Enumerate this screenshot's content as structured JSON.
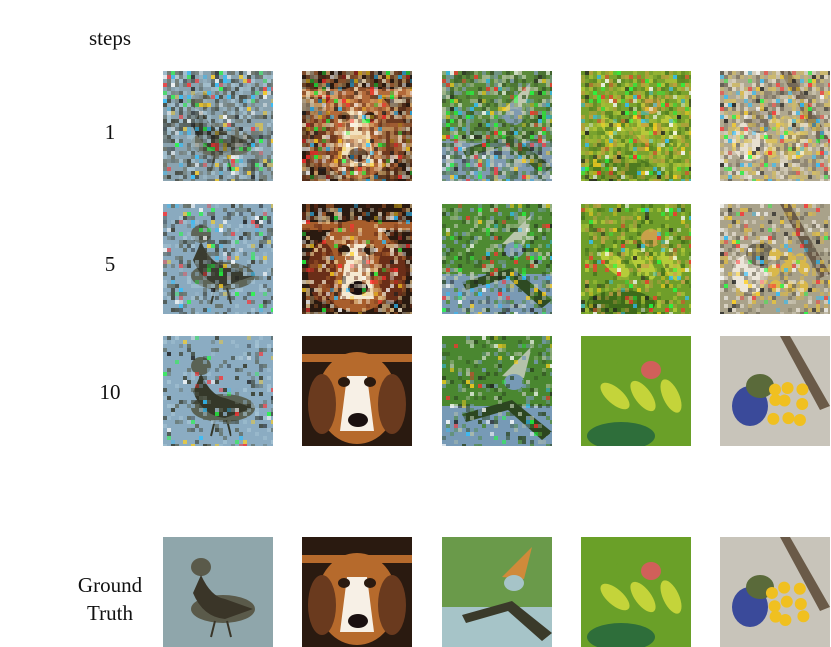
{
  "header_label": "steps",
  "rows": [
    {
      "label": "1",
      "tiles": [
        {
          "subject": "bird",
          "stage": "noisy-1",
          "palette": [
            "#8aa3b0",
            "#6b6f62",
            "#a9c7d6",
            "#3d3f33"
          ]
        },
        {
          "subject": "dog",
          "stage": "noisy-1",
          "palette": [
            "#b36a3a",
            "#e0b070",
            "#6e3a20",
            "#f2e2c0"
          ]
        },
        {
          "subject": "branch-bird",
          "stage": "noisy-1",
          "palette": [
            "#5a8a3a",
            "#7f9ab0",
            "#3a5a2a",
            "#c0c8b0"
          ]
        },
        {
          "subject": "parrot",
          "stage": "noisy-1",
          "palette": [
            "#7aa32e",
            "#b8c83a",
            "#4e7a20",
            "#c8a040"
          ]
        },
        {
          "subject": "lorikeet",
          "stage": "noisy-1",
          "palette": [
            "#b0a890",
            "#d8c060",
            "#7a7060",
            "#e8e0d0"
          ]
        }
      ]
    },
    {
      "label": "5",
      "tiles": [
        {
          "subject": "bird",
          "stage": "noisy-5",
          "palette": [
            "#8aaabf",
            "#5e6558",
            "#a7c4d4",
            "#3a3c30"
          ]
        },
        {
          "subject": "dog",
          "stage": "noisy-5",
          "palette": [
            "#a85e2c",
            "#e8c890",
            "#6a2e18",
            "#f5ead2"
          ]
        },
        {
          "subject": "branch-bird",
          "stage": "noisy-5",
          "palette": [
            "#4e8a32",
            "#7a9ab4",
            "#2e4a22",
            "#b9c6ac"
          ]
        },
        {
          "subject": "parrot",
          "stage": "noisy-5",
          "palette": [
            "#6f9e2a",
            "#b6cc3a",
            "#3e6a1a",
            "#c9a04a"
          ]
        },
        {
          "subject": "lorikeet",
          "stage": "noisy-5",
          "palette": [
            "#a9a28a",
            "#d9b84a",
            "#6e6858",
            "#ece6da"
          ]
        }
      ]
    },
    {
      "label": "10",
      "tiles": [
        {
          "subject": "bird",
          "stage": "noisy-10",
          "palette": [
            "#8bacc2",
            "#5a6254",
            "#a8c6d6",
            "#353829"
          ]
        },
        {
          "subject": "dog",
          "stage": "clean",
          "palette": [
            "#b66a2c",
            "#f0d6b0",
            "#6a3a1e",
            "#f7f0e6"
          ]
        },
        {
          "subject": "branch-bird",
          "stage": "noisy-10",
          "palette": [
            "#4a8730",
            "#779ab6",
            "#2c4620",
            "#b4c2aa"
          ]
        },
        {
          "subject": "parrot",
          "stage": "clean",
          "palette": [
            "#6aa028",
            "#c4d43a",
            "#2e6e3a",
            "#d0605a"
          ]
        },
        {
          "subject": "lorikeet",
          "stage": "clean",
          "palette": [
            "#c8c4ba",
            "#f0c020",
            "#5a6a3a",
            "#3a4a9a"
          ]
        }
      ]
    }
  ],
  "ground_truth": {
    "label_line1": "Ground",
    "label_line2": "Truth",
    "tiles": [
      {
        "subject": "bird",
        "stage": "clean",
        "palette": [
          "#8fa6ab",
          "#5a5a4a",
          "#a8b8ba",
          "#3a3528"
        ]
      },
      {
        "subject": "dog",
        "stage": "clean",
        "palette": [
          "#b66a2c",
          "#f0d6b0",
          "#6a3a1e",
          "#f7f0e6"
        ]
      },
      {
        "subject": "branch-bird",
        "stage": "clean",
        "palette": [
          "#6a9a4a",
          "#a6c4c8",
          "#3a3a2a",
          "#d08a3a"
        ]
      },
      {
        "subject": "parrot",
        "stage": "clean",
        "palette": [
          "#6aa028",
          "#c4d43a",
          "#2e6e3a",
          "#d0605a"
        ]
      },
      {
        "subject": "lorikeet",
        "stage": "clean",
        "palette": [
          "#c8c4ba",
          "#f0c020",
          "#5a6a3a",
          "#3a4a9a"
        ]
      }
    ]
  }
}
